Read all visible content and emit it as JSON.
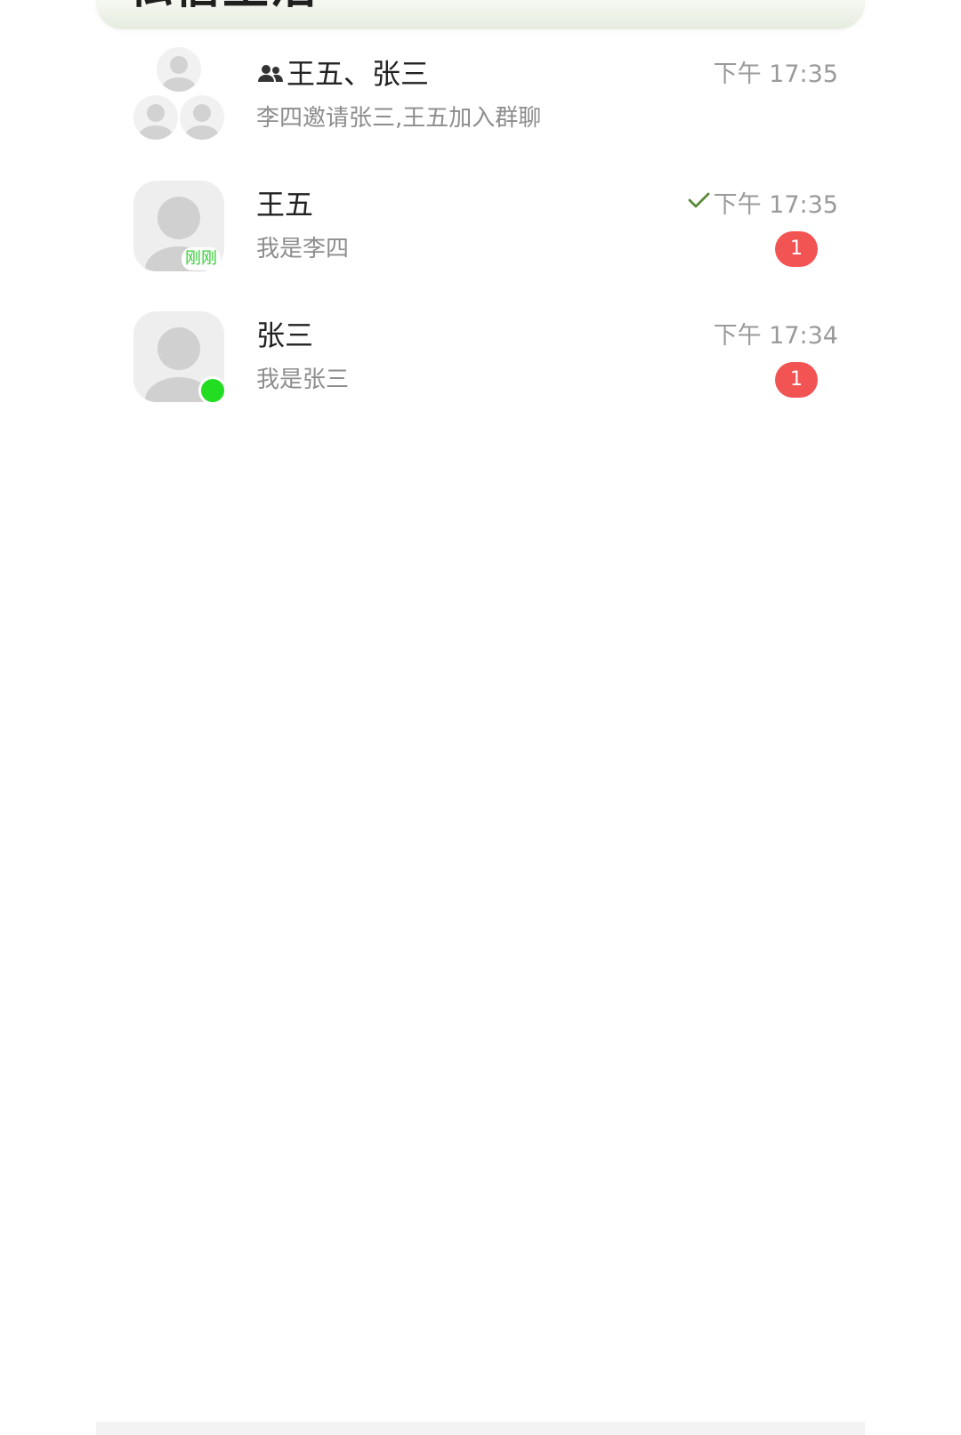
{
  "header": {
    "title": "私信生活"
  },
  "chats": [
    {
      "name": "王五、张三",
      "preview": "李四邀请张三,王五加入群聊",
      "time": "下午 17:35",
      "is_group": true
    },
    {
      "name": "王五",
      "preview": "我是李四",
      "time": "下午 17:35",
      "status_label": "刚刚",
      "read_check": true,
      "unread": "1"
    },
    {
      "name": "张三",
      "preview": "我是张三",
      "time": "下午 17:34",
      "online": true,
      "unread": "1"
    }
  ],
  "colors": {
    "badge": "#f25454",
    "online": "#22dd22",
    "just_now": "#33cc33",
    "check": "#5a8a3a"
  },
  "icons": {
    "group_chat": "group-icon",
    "read_receipt": "check-icon"
  }
}
